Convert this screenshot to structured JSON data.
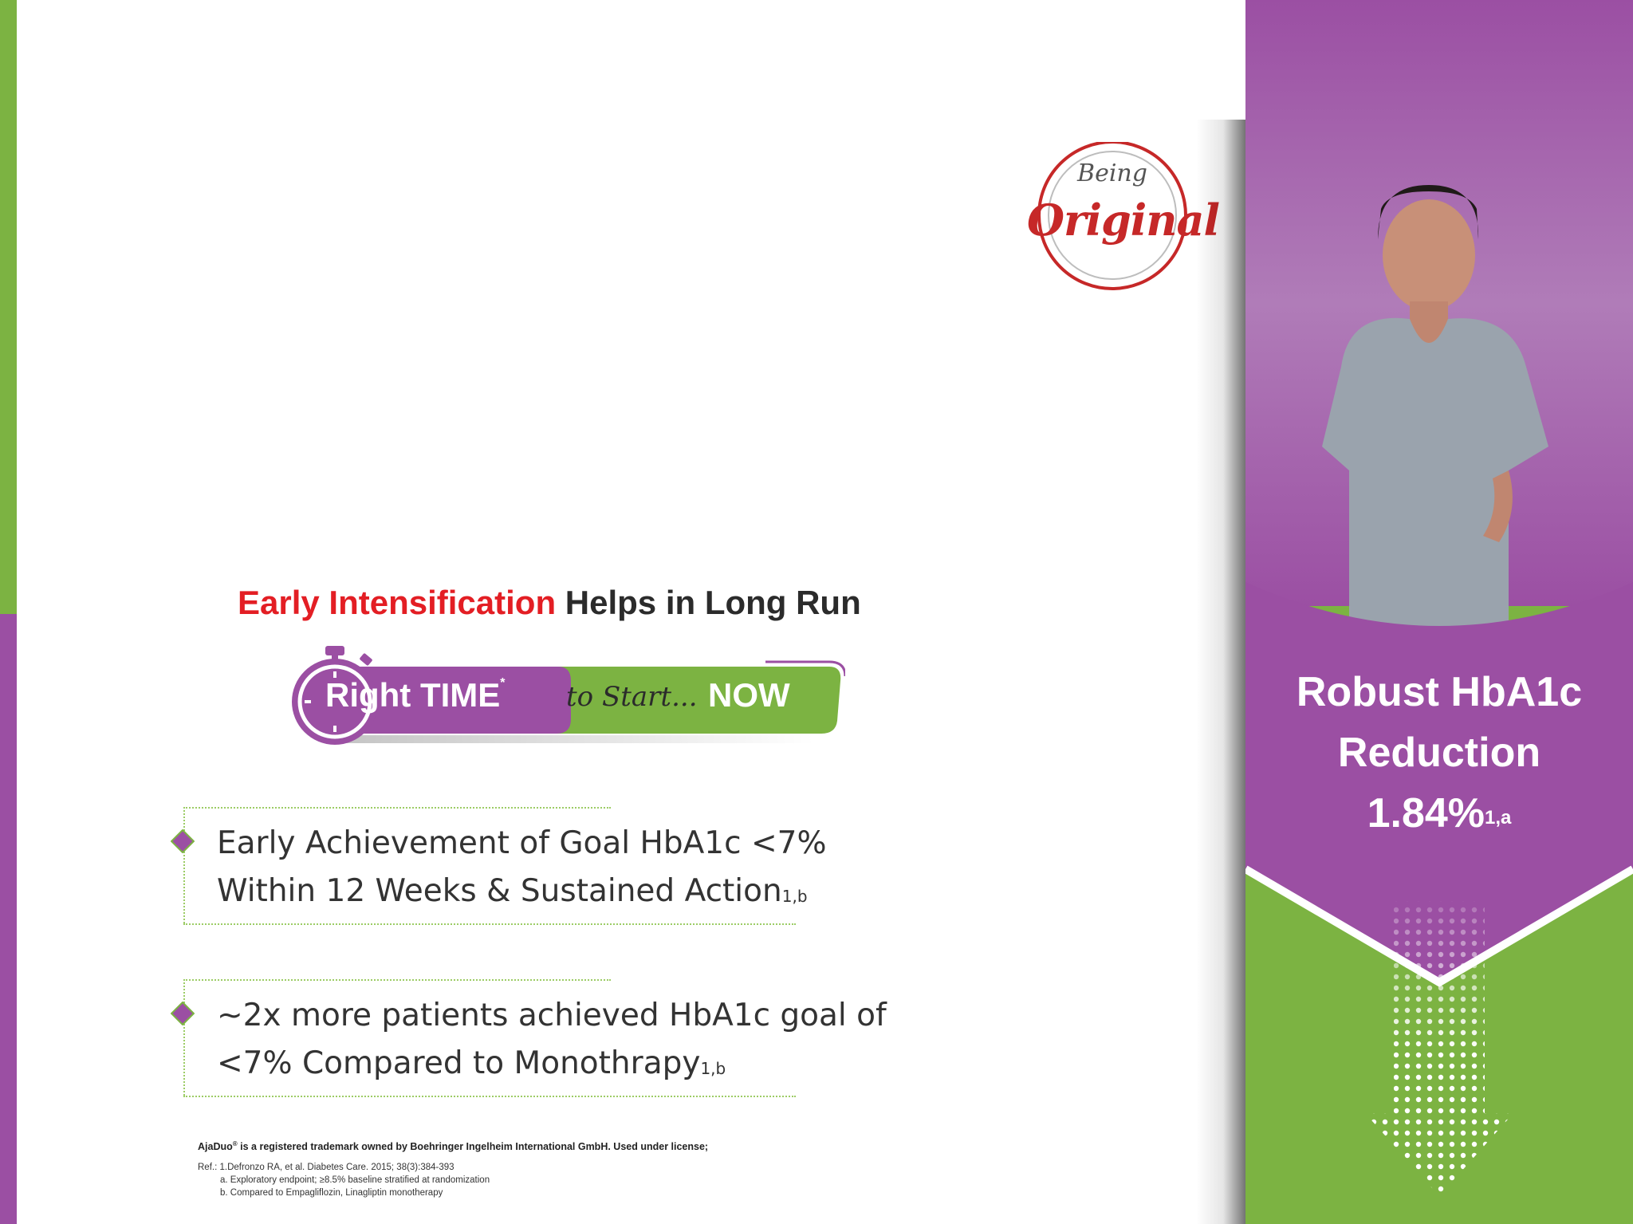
{
  "logo": {
    "line1": "Being",
    "line2": "Original"
  },
  "heading": {
    "highlight": "Early Intensification",
    "rest": "Helps in Long Run"
  },
  "badge": {
    "right_time": "Right TIME",
    "asterisk": "*",
    "to_start": "to Start...",
    "now": "NOW"
  },
  "bullets": [
    {
      "line1": "Early Achievement of Goal HbA1c <7%",
      "line2": "Within 12 Weeks & Sustained Action",
      "sup": "1,b"
    },
    {
      "line1": "~2x more patients achieved HbA1c goal of",
      "line2": "<7% Compared to Monothrapy",
      "sup": "1,b"
    }
  ],
  "panel": {
    "line1": "Robust HbA1c",
    "line2": "Reduction",
    "value": "1.84%",
    "sup": "1,a"
  },
  "footer": {
    "brand": "AjaDuo",
    "reg": "®",
    "trademark": " is a registered trademark owned by Boehringer Ingelheim International GmbH. Used under license;",
    "ref1": "Ref.: 1.Defronzo RA, et al. Diabetes Care. 2015; 38(3):384-393",
    "ref2": "a. Exploratory endpoint; ≥8.5% baseline stratified at randomization",
    "ref3": "b. Compared to Empagliflozin, Linagliptin monotherapy"
  },
  "colors": {
    "purple": "#9b4fa3",
    "green": "#7cb342",
    "red": "#e31e24"
  }
}
